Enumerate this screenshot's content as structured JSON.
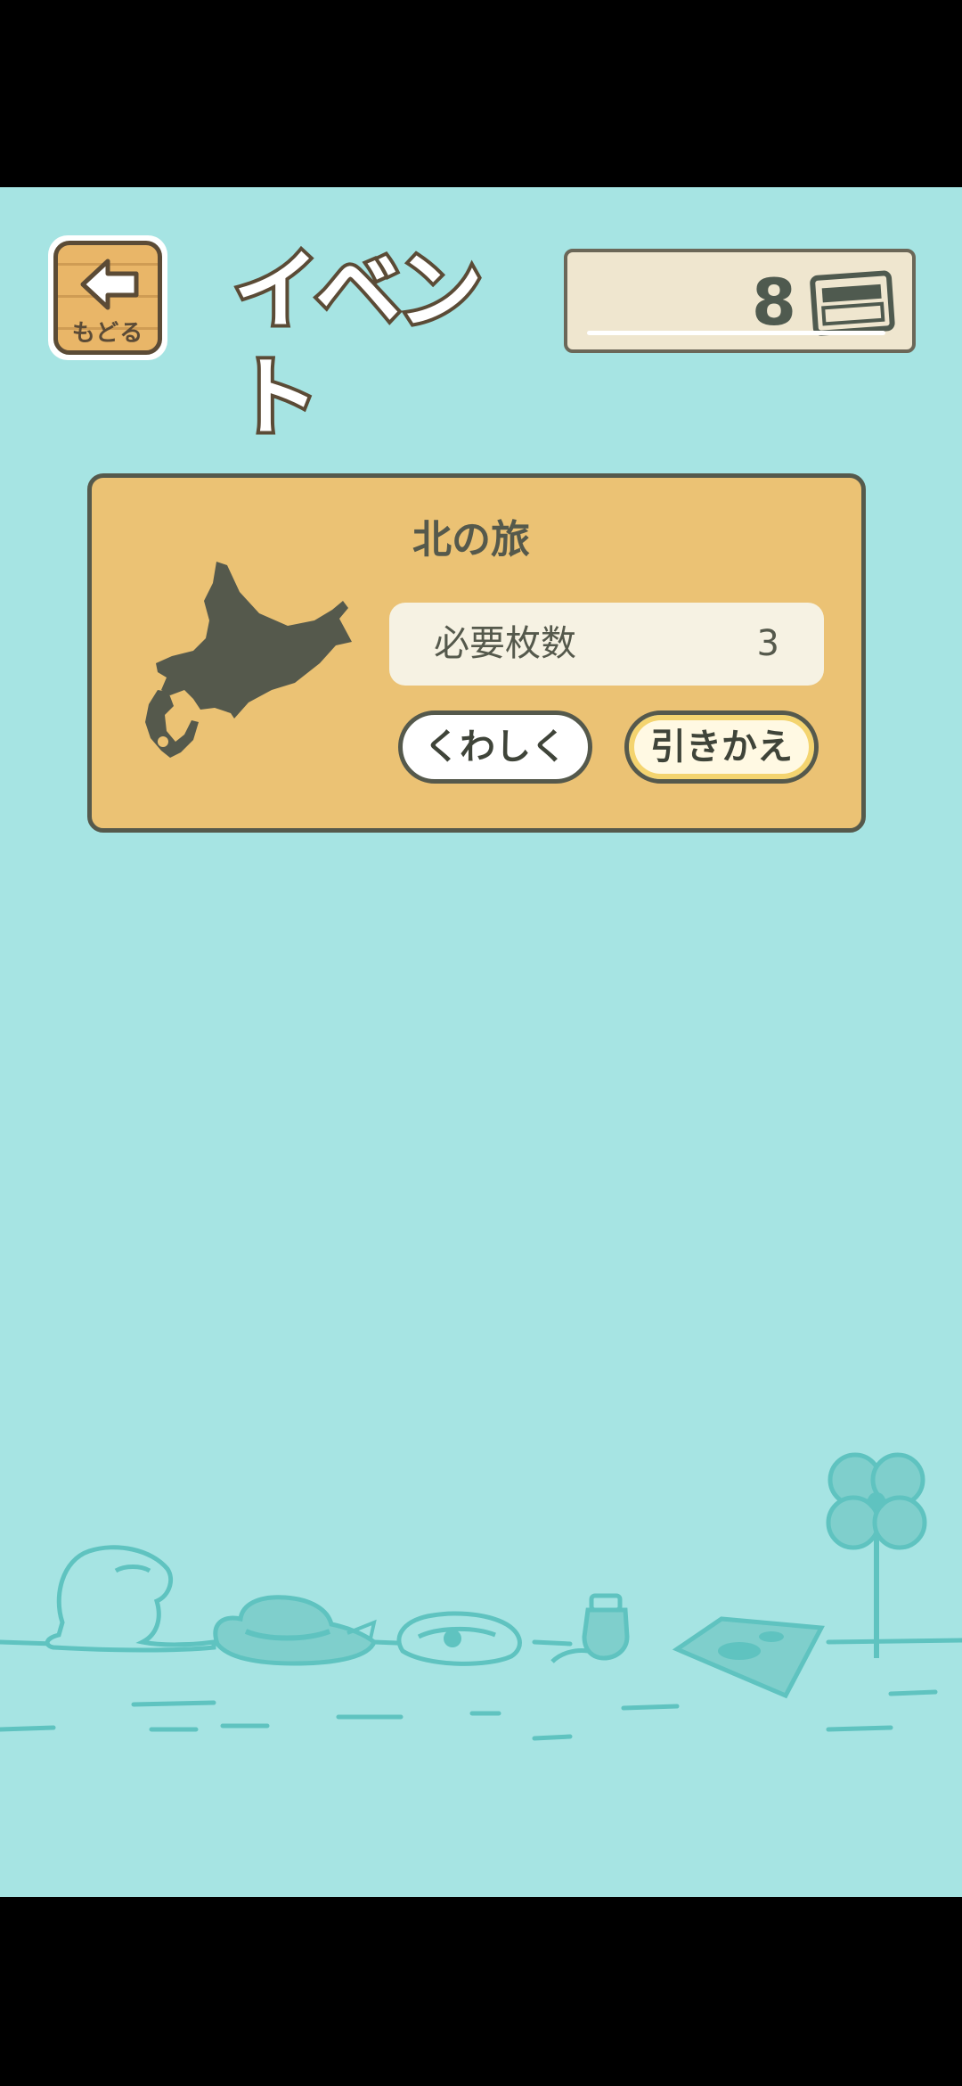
{
  "header": {
    "back_label": "もどる",
    "title": "イベント",
    "ticket_count": "8"
  },
  "event": {
    "title": "北の旅",
    "required_label": "必要枚数",
    "required_value": "3",
    "details_button": "くわしく",
    "exchange_button": "引きかえ"
  },
  "colors": {
    "background": "#a6e4e3",
    "card": "#ebc274",
    "outline": "#55594c",
    "scene_line": "#5fc3c0"
  },
  "icons": {
    "back": "back-arrow-icon",
    "ticket": "ticket-icon",
    "map": "hokkaido-map-icon"
  }
}
